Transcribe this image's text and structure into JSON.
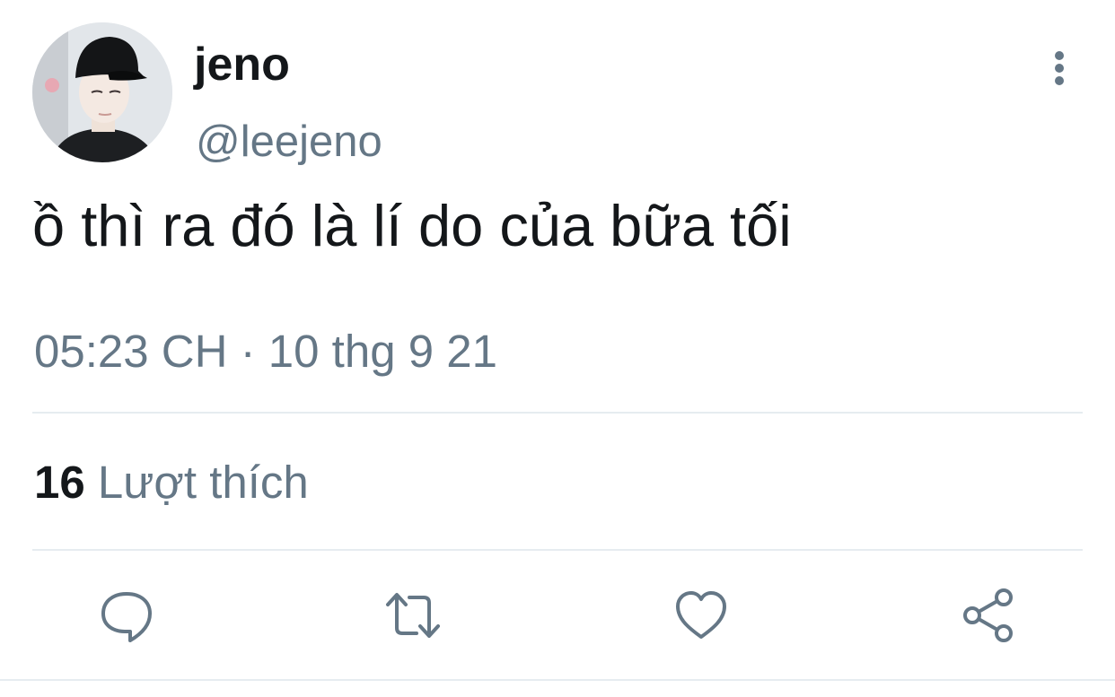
{
  "tweet": {
    "display_name": "jeno",
    "handle": "@leejeno",
    "text": "ồ thì ra đó là lí do của bữa tối",
    "timestamp": "05:23 CH · 10 thg 9 21"
  },
  "stats": {
    "likes_count": "16",
    "likes_label": "Lượt thích"
  },
  "actions": [
    {
      "name": "reply",
      "icon": "speech-bubble-icon"
    },
    {
      "name": "retweet",
      "icon": "retweet-arrows-icon"
    },
    {
      "name": "like",
      "icon": "heart-icon"
    },
    {
      "name": "share",
      "icon": "share-nodes-icon"
    }
  ],
  "colors": {
    "primary_text": "#14171a",
    "secondary_text": "#657786",
    "divider": "#e6ecf0",
    "background": "#ffffff"
  }
}
